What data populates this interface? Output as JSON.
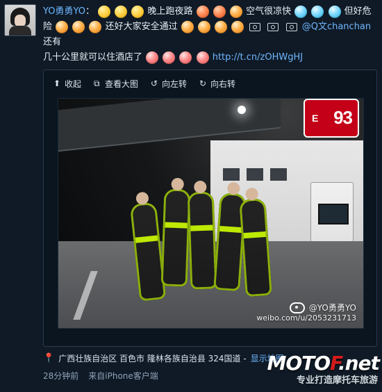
{
  "post": {
    "username": "YO勇勇YO",
    "colon": "：",
    "segments": {
      "s1": "晚上跑夜路",
      "s2": "空气很凉快",
      "s3": "但好危",
      "s4": "险",
      "s5": "还好大家安全通过",
      "mention": "@Q文chanchan",
      "s6": " 还有",
      "s7": "几十公里就可以住酒店了",
      "link": "http://t.cn/zOHWgHJ"
    },
    "icons": {
      "emoji": "emoji-face",
      "camera": "camera-icon"
    }
  },
  "image_toolbar": {
    "collapse": "收起",
    "view_large": "查看大图",
    "rotate_left": "向左转",
    "rotate_right": "向右转"
  },
  "photo": {
    "sign_text": "93",
    "sign_prefix": "E",
    "watermark_user": "@YO勇勇YO",
    "watermark_url": "weibo.com/u/2053231713"
  },
  "location": {
    "text": "广西壮族自治区 百色市 隆林各族自治县 324国道 -",
    "map_link": "显示地图"
  },
  "meta": {
    "time": "28分钟前",
    "source": "来自iPhone客户端"
  },
  "brand": {
    "logo_main": "MOTO",
    "logo_mid": "F",
    "logo_tail": ".net",
    "tagline": "专业打造摩托车旅游"
  },
  "colors": {
    "background": "#0f1a26",
    "link": "#6fb7ff",
    "text": "#e6eef5",
    "accent_red": "#d31b1b"
  }
}
